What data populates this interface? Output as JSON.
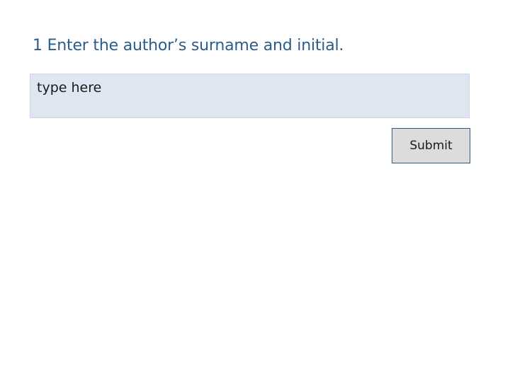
{
  "question": {
    "text": "1 Enter the author’s surname and initial."
  },
  "answer": {
    "value": "",
    "placeholder": "type here"
  },
  "submit": {
    "label": "Submit"
  }
}
